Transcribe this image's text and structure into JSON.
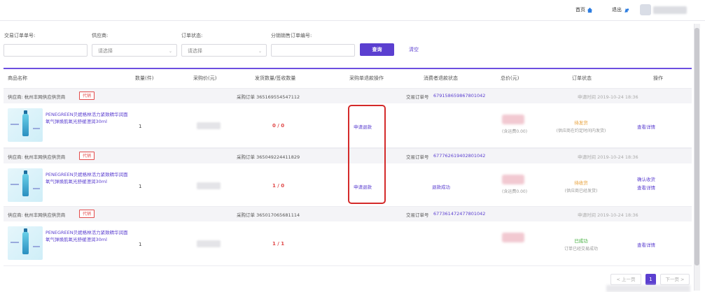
{
  "header": {
    "home_label": "首页",
    "logout_label": "退出"
  },
  "filters": {
    "order_no_label": "交易订单单号:",
    "supplier_label": "供应商:",
    "supplier_placeholder": "请选择",
    "status_label": "订单状态:",
    "status_placeholder": "请选择",
    "dist_order_label": "分销销售订单编号:",
    "query_label": "查询",
    "clear_label": "清空"
  },
  "table": {
    "headers": [
      "商品名称",
      "数量(件)",
      "采购价(元)",
      "发货数量/签收数量",
      "采购单退款操作",
      "消费者退款状态",
      "总价(元)",
      "订单状态",
      "操作"
    ]
  },
  "orders": [
    {
      "supplier": "供应商: 杭州丰网供应供货商",
      "tag": "代销",
      "purchase_no": "采购订单 365169554547112",
      "trade_no_label": "交易订单号",
      "trade_no": "679158659867801042",
      "apply_time": "申请时间 2019-10-24 18:36",
      "product": "PENEGREEN贝妮格林活力紧致精华润面氧气弹焕肌氧光舒缓澄润30ml",
      "qty": "1",
      "ratio": "0 / 0",
      "refund_action": "申请退款",
      "refund_status": "",
      "total_sub": "(含运费0.00)",
      "status_main": "待发货",
      "status_color": "#e8a13a",
      "status_sub": "(供应商在约定时间内发货)",
      "ops": [
        "查看详情"
      ]
    },
    {
      "supplier": "供应商: 杭州丰网供应供货商",
      "tag": "代销",
      "purchase_no": "采购订单 365049224411829",
      "trade_no_label": "交易订单号",
      "trade_no": "677762619402801042",
      "apply_time": "申请时间 2019-10-24 18:36",
      "product": "PENEGREEN贝妮格林活力紧致精华润面氧气弹焕肌氧光舒缓澄润30ml",
      "qty": "1",
      "ratio": "1 / 0",
      "refund_action": "申请退款",
      "refund_status": "退款成功",
      "total_sub": "(含运费0.00)",
      "status_main": "待收货",
      "status_color": "#e8a13a",
      "status_sub": "(供应商已经发货)",
      "ops": [
        "确认收货",
        "查看详情"
      ]
    },
    {
      "supplier": "供应商: 杭州丰网供应供货商",
      "tag": "代销",
      "purchase_no": "采购订单 365017065681114",
      "trade_no_label": "交易订单号",
      "trade_no": "677361472477801042",
      "apply_time": "申请时间 2019-10-24 18:36",
      "product": "PENEGREEN贝妮格林活力紧致精华润面氧气弹焕肌氧光舒缓澄润30ml",
      "qty": "1",
      "ratio": "1 / 1",
      "refund_action": "",
      "refund_status": "",
      "total_sub": "",
      "status_main": "已成功",
      "status_color": "#3fae3a",
      "status_sub": "订单已经交易成功",
      "ops": [
        "查看详情"
      ]
    }
  ],
  "pagination": {
    "prev_label": "< 上一页",
    "current": "1",
    "next_label": "下一页 >"
  }
}
